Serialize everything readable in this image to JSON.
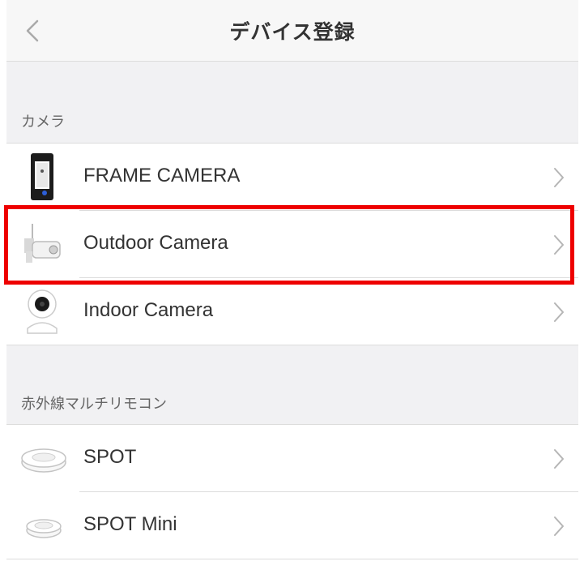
{
  "header": {
    "title": "デバイス登録",
    "back_icon": "chevron-left-icon"
  },
  "sections": [
    {
      "label": "カメラ"
    },
    {
      "label": "赤外線マルチリモコン"
    }
  ],
  "items": [
    {
      "label": "FRAME CAMERA",
      "icon": "frame-camera-icon"
    },
    {
      "label": "Outdoor Camera",
      "icon": "outdoor-camera-icon"
    },
    {
      "label": "Indoor Camera",
      "icon": "indoor-camera-icon"
    },
    {
      "label": "SPOT",
      "icon": "spot-remote-icon"
    },
    {
      "label": "SPOT Mini",
      "icon": "spot-mini-remote-icon"
    }
  ],
  "colors": {
    "highlight": "#ee0000",
    "section_bg": "#f1f1f3",
    "header_bg": "#f7f7f7"
  }
}
